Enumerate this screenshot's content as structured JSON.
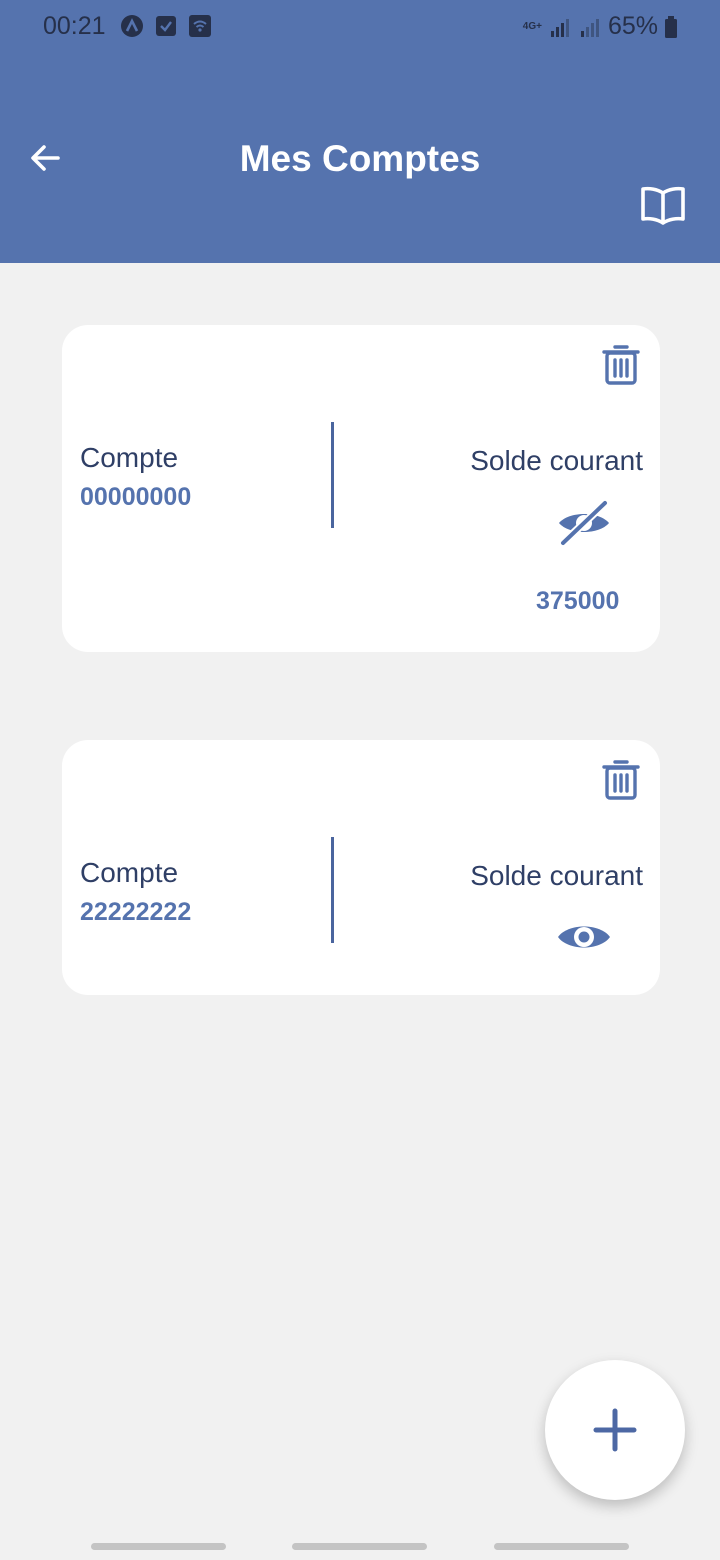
{
  "status_bar": {
    "time": "00:21",
    "network": "4G+",
    "battery": "65%",
    "icons": [
      "app-a-icon",
      "checkbox-icon",
      "wifi-calling-icon",
      "signal-icon",
      "signal-icon",
      "battery-icon"
    ]
  },
  "header": {
    "title": "Mes Comptes",
    "back_icon": "arrow-left-icon",
    "book_icon": "open-book-icon"
  },
  "accounts": [
    {
      "label": "Compte",
      "number": "00000000",
      "balance_label": "Solde courant",
      "balance": "375000",
      "visibility_icon": "eye-off-icon",
      "delete_icon": "trash-icon"
    },
    {
      "label": "Compte",
      "number": "22222222",
      "balance_label": "Solde courant",
      "visibility_icon": "eye-icon",
      "delete_icon": "trash-icon"
    }
  ],
  "fab": {
    "icon": "plus-icon"
  },
  "colors": {
    "primary": "#5573ae",
    "background": "#f1f1f1",
    "card": "#ffffff",
    "text_dark": "#2f3f66"
  }
}
